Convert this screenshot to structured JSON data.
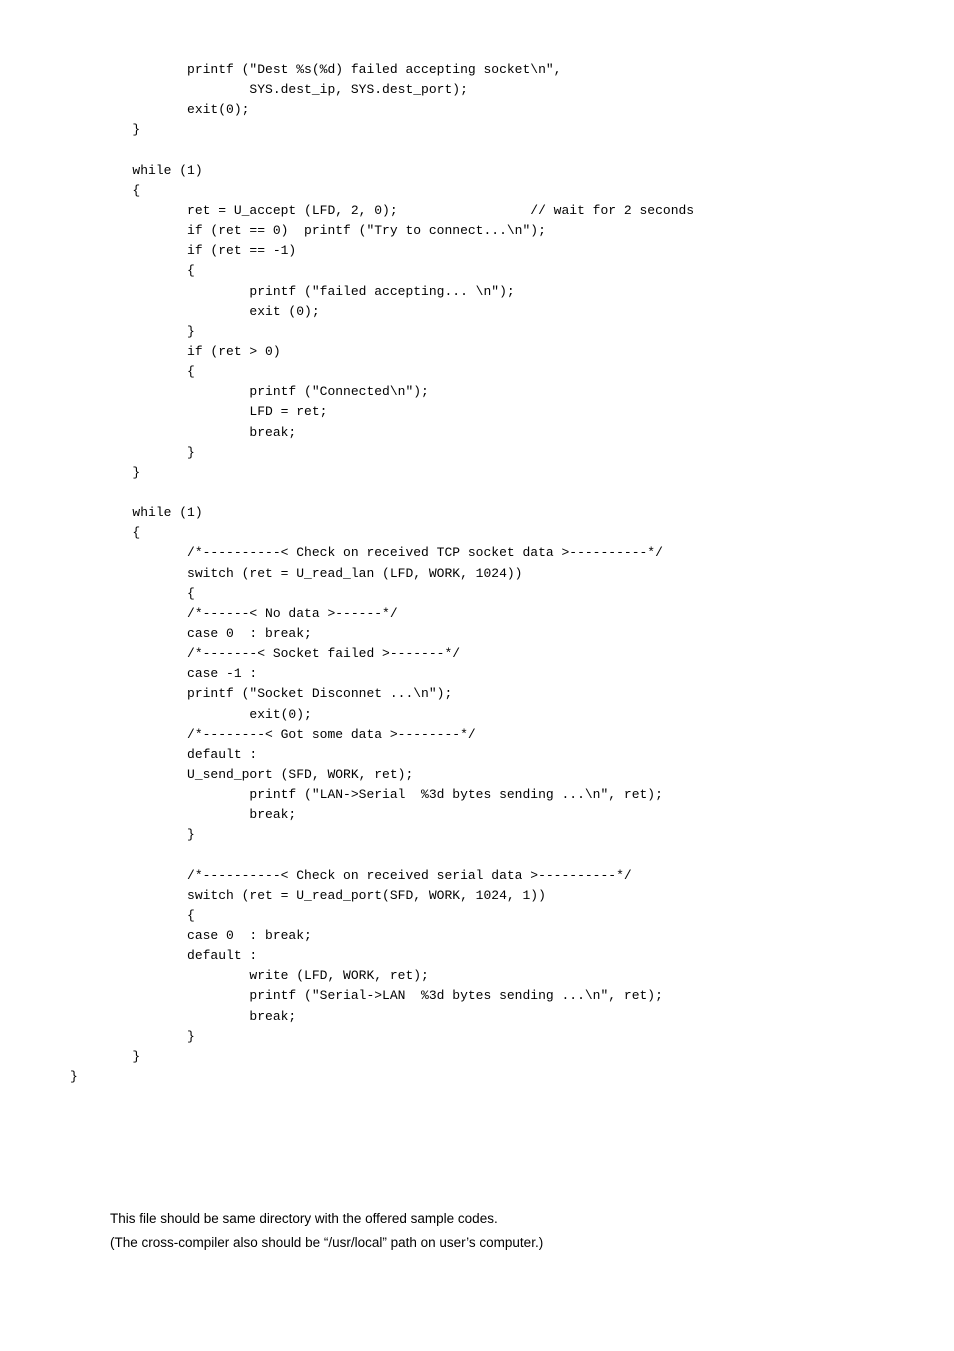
{
  "code": "               printf (\"Dest %s(%d) failed accepting socket\\n\",\n                       SYS.dest_ip, SYS.dest_port);\n               exit(0);\n        }\n\n        while (1)\n        {\n               ret = U_accept (LFD, 2, 0);                 // wait for 2 seconds\n               if (ret == 0)  printf (\"Try to connect...\\n\");\n               if (ret == -1)\n               {\n                       printf (\"failed accepting... \\n\");\n                       exit (0);\n               }\n               if (ret > 0)\n               {\n                       printf (\"Connected\\n\");\n                       LFD = ret;\n                       break;\n               }\n        }\n\n        while (1)\n        {\n               /*----------< Check on received TCP socket data >----------*/\n               switch (ret = U_read_lan (LFD, WORK, 1024))\n               {\n               /*------< No data >------*/\n               case 0  : break;\n               /*-------< Socket failed >-------*/\n               case -1 :\n               printf (\"Socket Disconnet ...\\n\");\n                       exit(0);\n               /*--------< Got some data >--------*/\n               default :\n               U_send_port (SFD, WORK, ret);\n                       printf (\"LAN->Serial  %3d bytes sending ...\\n\", ret);\n                       break;\n               }\n\n               /*----------< Check on received serial data >----------*/\n               switch (ret = U_read_port(SFD, WORK, 1024, 1))\n               {\n               case 0  : break;\n               default :\n                       write (LFD, WORK, ret);\n                       printf (\"Serial->LAN  %3d bytes sending ...\\n\", ret);\n                       break;\n               }\n        }\n}",
  "para1": "This file should be same directory with the offered sample codes.",
  "para2": "(The cross-compiler also should be “/usr/local” path on user’s computer.)"
}
